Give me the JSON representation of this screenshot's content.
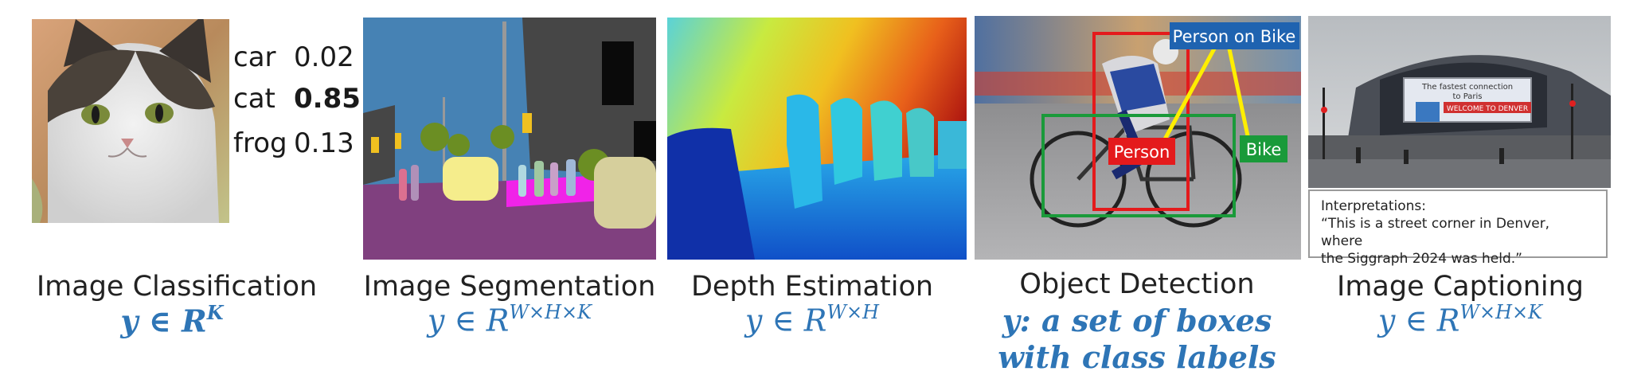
{
  "classification": {
    "title": "Image Classification",
    "formula": {
      "var": "y",
      "rel": "∈",
      "set": "R",
      "exp": "K"
    },
    "scores": [
      {
        "label": "car",
        "value": "0.02",
        "top": false
      },
      {
        "label": "cat",
        "value": "0.85",
        "top": true
      },
      {
        "label": "frog",
        "value": "0.13",
        "top": false
      }
    ]
  },
  "segmentation": {
    "title": "Image Segmentation",
    "formula": {
      "var": "y",
      "rel": "∈",
      "set": "R",
      "exp": "W×H×K"
    }
  },
  "depth": {
    "title": "Depth Estimation",
    "formula": {
      "var": "y",
      "rel": "∈",
      "set": "R",
      "exp": "W×H"
    }
  },
  "detection": {
    "title": "Object Detection",
    "formula_line1": "y: a set of boxes",
    "formula_line2": "with class labels",
    "labels": {
      "person_on_bike": "Person on Bike",
      "person": "Person",
      "bike": "Bike"
    },
    "colors": {
      "red": "#e41a1c",
      "green": "#1a9a3a",
      "blue": "#1f63b0",
      "yellow": "#ffee00"
    }
  },
  "captioning": {
    "title": "Image Captioning",
    "formula": {
      "var": "y",
      "rel": "∈",
      "set": "R",
      "exp": "W×H×K"
    },
    "sign_line1": "The fastest connection",
    "sign_line2": "to Paris",
    "banner": "WELCOME TO DENVER",
    "interp_heading": "Interpretations:",
    "interp_line1": "“This is a street corner in Denver, where",
    "interp_line2": "the Siggraph 2024 was held.”"
  },
  "theme": {
    "formula_color": "#2e75b6",
    "text_color": "#222222"
  }
}
